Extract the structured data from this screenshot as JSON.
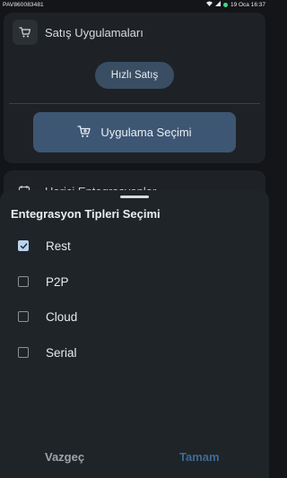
{
  "status_bar": {
    "left_text": "PAV860083481",
    "right_text": "19 Oca 16:37"
  },
  "sales_card": {
    "title": "Satış Uygulamaları",
    "quick_sale_label": "Hızlı Satış",
    "app_select_label": "Uygulama Seçimi"
  },
  "integration_card": {
    "title": "Harici Entegrasyonlar"
  },
  "sheet": {
    "title": "Entegrasyon Tipleri Seçimi",
    "options": [
      {
        "label": "Rest",
        "checked": true
      },
      {
        "label": "P2P",
        "checked": false
      },
      {
        "label": "Cloud",
        "checked": false
      },
      {
        "label": "Serial",
        "checked": false
      }
    ],
    "cancel_label": "Vazgeç",
    "ok_label": "Tamam"
  },
  "colors": {
    "accent": "#3d5673",
    "checkbox_checked": "#b9d3ee",
    "ok_text": "#3e6b97"
  },
  "icons": {
    "cart": "cart-icon",
    "calendar": "calendar-icon",
    "check": "check-icon"
  }
}
